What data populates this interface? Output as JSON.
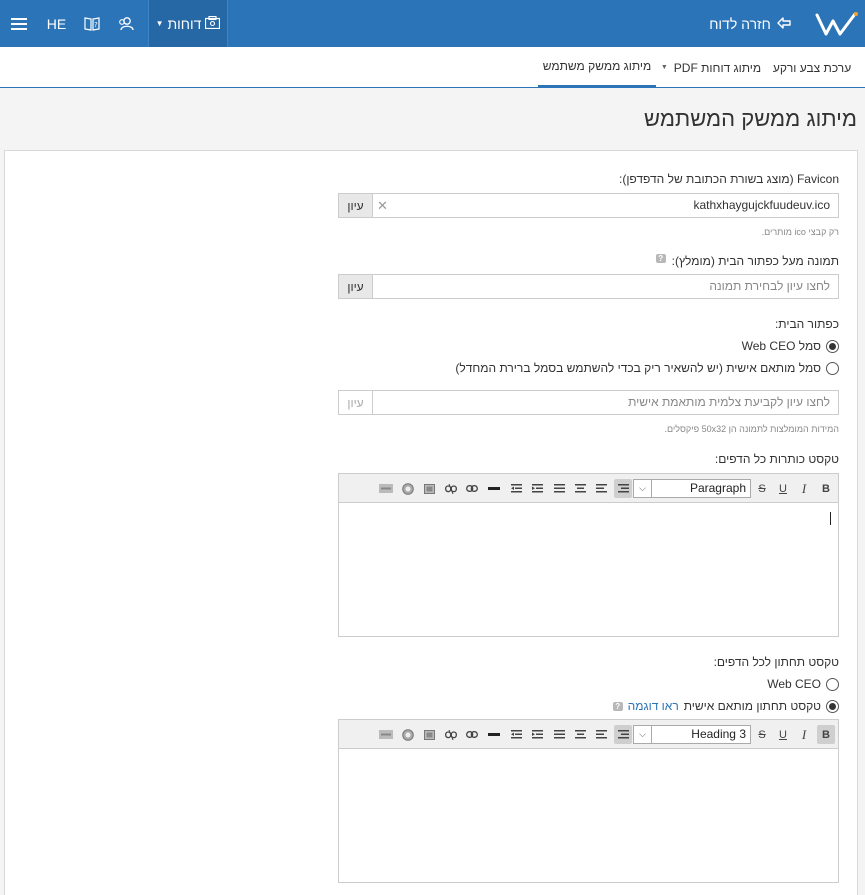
{
  "topbar": {
    "language": "HE",
    "reports_label": "דוחות",
    "back_label": "חזרה לדוח"
  },
  "tabs": [
    {
      "label": "ערכת צבע ורקע"
    },
    {
      "label": "מיתוג דוחות PDF"
    },
    {
      "label": "מיתוג ממשק משתמש",
      "active": true
    }
  ],
  "page": {
    "title": "מיתוג ממשק המשתמש"
  },
  "favicon": {
    "label": "Favicon (מוצג בשורת הכתובת של הדפדפן):",
    "value": "kathxhaygujckfuudeuv.ico",
    "browse": "עיון",
    "hint": "רק קבצי ico מותרים."
  },
  "home_image": {
    "label": "תמונה מעל כפתור הבית (מומלץ):",
    "placeholder": "לחצו עיון לבחירת תמונה",
    "browse": "עיון"
  },
  "home_button": {
    "label": "כפתור הבית:",
    "option_webceo": "סמל Web CEO",
    "option_custom": "סמל מותאם אישית (יש להשאיר ריק בכדי להשתמש בסמל ברירת המחדל)",
    "placeholder": "לחצו עיון לקביעת צלמית מותאמת אישית",
    "browse": "עיון",
    "hint": "המידות המומלצות לתמונה הן 50x32 פיקסלים."
  },
  "header_text": {
    "label": "טקסט כותרות כל הדפים:",
    "format": "Paragraph"
  },
  "footer_text": {
    "label": "טקסט תחתון לכל הדפים:",
    "option_webceo": "Web CEO",
    "option_custom": "טקסט תחתון מותאם אישית",
    "example_link": "ראו דוגמה",
    "format": "Heading 3"
  },
  "toolbar_icons": [
    "bold-icon",
    "italic-icon",
    "underline-icon",
    "strikethrough-icon",
    "align-right-icon",
    "align-left-icon",
    "align-center-icon",
    "justify-icon",
    "outdent-icon",
    "indent-icon",
    "horizontal-rule-icon",
    "link-icon",
    "unlink-icon",
    "image-icon",
    "emoji-icon",
    "html-icon"
  ],
  "colors": {
    "accent": "#2b74b8"
  }
}
